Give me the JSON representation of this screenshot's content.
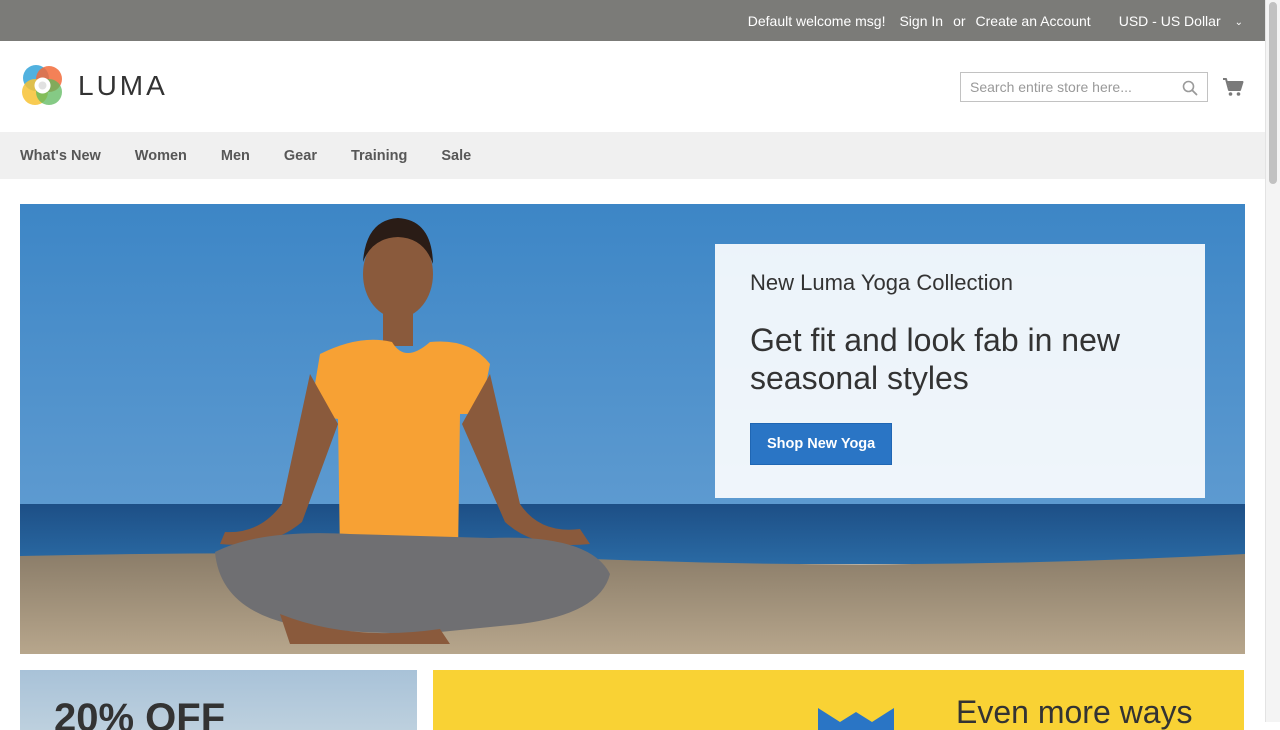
{
  "panel": {
    "welcome": "Default welcome msg!",
    "sign_in": "Sign In",
    "or": "or",
    "create_account": "Create an Account",
    "currency": "USD - US Dollar"
  },
  "header": {
    "logo_text": "LUMA",
    "search": {
      "placeholder": "Search entire store here...",
      "value": ""
    },
    "icons": {
      "search": "search-icon",
      "cart": "cart-icon"
    }
  },
  "nav": {
    "items": [
      {
        "label": "What's New"
      },
      {
        "label": "Women"
      },
      {
        "label": "Men"
      },
      {
        "label": "Gear"
      },
      {
        "label": "Training"
      },
      {
        "label": "Sale"
      }
    ]
  },
  "hero": {
    "subtitle": "New Luma Yoga Collection",
    "title": "Get fit and look fab in new seasonal styles",
    "button": "Shop New Yoga"
  },
  "promos": {
    "left_text": "20% OFF",
    "right_text": "Even more ways"
  },
  "colors": {
    "panel_bg": "#7b7b78",
    "nav_bg": "#f0f0f0",
    "primary_button": "#2a75c5",
    "promo_yellow": "#f9d234"
  }
}
